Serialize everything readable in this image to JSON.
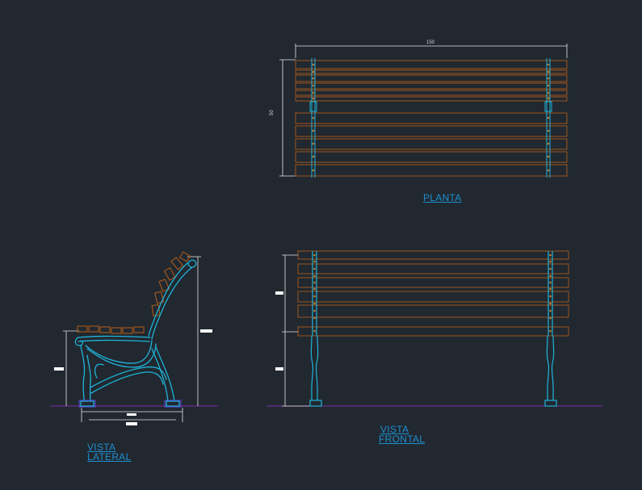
{
  "colors": {
    "background": "#212830",
    "wood": "#a0561c",
    "wood_dot": "#c27a30",
    "iron": "#1fb4d8",
    "dimension": "#e6e6e6",
    "ground": "#7a2fa8",
    "label": "#1f8fd0"
  },
  "plan": {
    "title": "PLANTA",
    "width_dim": "150",
    "depth_dim": "50"
  },
  "side": {
    "title_line1": "VISTA",
    "title_line2": "LATERAL"
  },
  "front": {
    "title_line1": "VISTA",
    "title_line2": "FRONTAL"
  }
}
